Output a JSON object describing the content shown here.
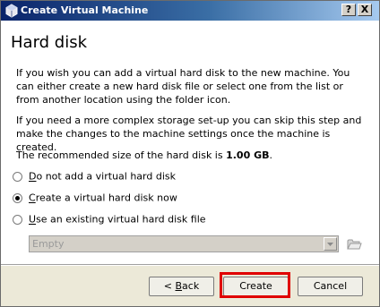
{
  "window": {
    "title": "Create Virtual Machine",
    "help_label": "?",
    "close_label": "X"
  },
  "page": {
    "heading": "Hard disk",
    "paragraph1": "If you wish you can add a virtual hard disk to the new machine. You can either create a new hard disk file or select one from the list or from another location using the folder icon.",
    "paragraph2": "If you need a more complex storage set-up you can skip this step and make the changes to the machine settings once the machine is created.",
    "recommended_prefix": "The recommended size of the hard disk is ",
    "recommended_size": "1.00 GB",
    "recommended_suffix": "."
  },
  "options": [
    {
      "first_letter": "D",
      "rest": "o not add a virtual hard disk",
      "checked": false
    },
    {
      "first_letter": "C",
      "rest": "reate a virtual hard disk now",
      "checked": true
    },
    {
      "first_letter": "U",
      "rest": "se an existing virtual hard disk file",
      "checked": false
    }
  ],
  "disk_select": {
    "value": "Empty",
    "enabled": false
  },
  "buttons": {
    "back_underlined": "< ",
    "back_key": "B",
    "back_rest": "ack",
    "create": "Create",
    "cancel": "Cancel"
  },
  "colors": {
    "highlight": "#e00000",
    "titlebar_start": "#0a246a",
    "titlebar_end": "#a6caf0"
  },
  "icons": {
    "title": "virtualbox-icon",
    "folder": "folder-open-icon",
    "combo_arrow": "chevron-down-icon"
  }
}
